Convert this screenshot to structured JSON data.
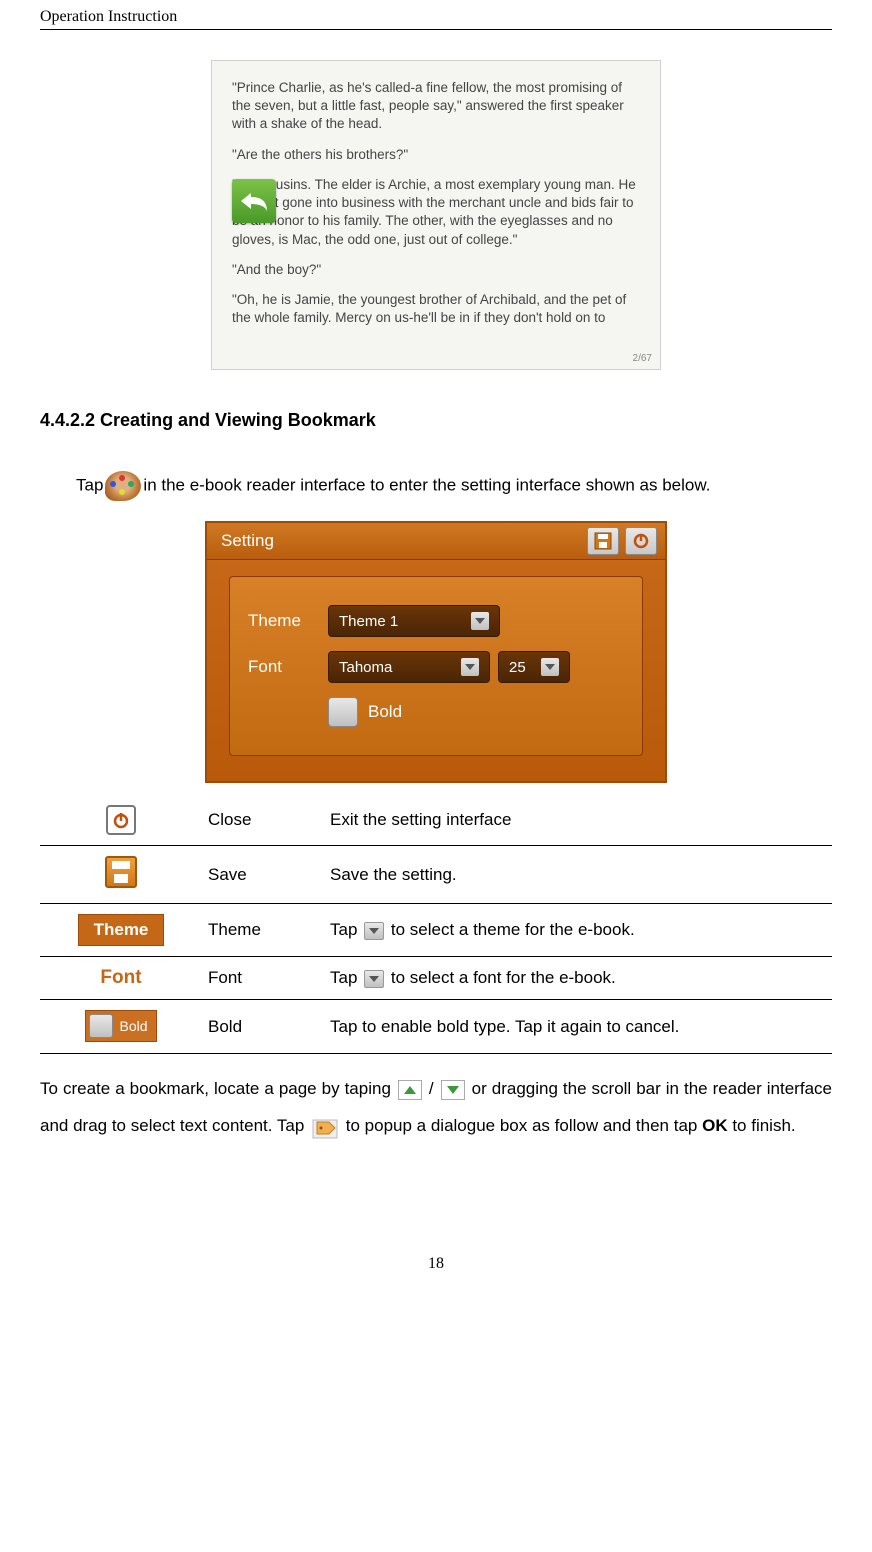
{
  "header": "Operation Instruction",
  "reader_screenshot": {
    "para1": "\"Prince Charlie, as he's called-a fine fellow, the most promising of the seven, but a little fast, people say,\" answered the first speaker with a shake of the head.",
    "para2": "\"Are the others his brothers?\"",
    "para3": "\"No, cousins. The elder is Archie, a most exemplary young man. He has just gone into business with the merchant uncle and bids fair to be an honor to his family. The other, with the eyeglasses and no gloves, is Mac, the odd one, just out of college.\"",
    "para4": "\"And the boy?\"",
    "para5": "\"Oh, he is Jamie, the youngest brother of Archibald, and the pet of the whole family. Mercy on us-he'll be in if they don't hold on to",
    "page_small": "2/67"
  },
  "section_title": "4.4.2.2 Creating and Viewing Bookmark",
  "intro_line_before": "Tap",
  "intro_line_after": "in the e-book reader interface to enter the setting interface shown as below.",
  "settings_screenshot": {
    "title": "Setting",
    "row_theme_label": "Theme",
    "row_theme_value": "Theme 1",
    "row_font_label": "Font",
    "row_font_value": "Tahoma",
    "row_font_size": "25",
    "row_bold_label": "Bold"
  },
  "table": {
    "rows": [
      {
        "label": "Close",
        "desc_before": "Exit the setting interface",
        "desc_after": "",
        "has_arrow": false
      },
      {
        "label": "Save",
        "desc_before": "Save the setting.",
        "desc_after": "",
        "has_arrow": false
      },
      {
        "label": "Theme",
        "desc_before": "Tap ",
        "desc_after": " to select a theme for the e-book.",
        "has_arrow": true
      },
      {
        "label": "Font",
        "desc_before": "Tap ",
        "desc_after": " to select a font for the e-book.",
        "has_arrow": true
      },
      {
        "label": "Bold",
        "desc_before": "Tap to enable bold type. Tap it again to cancel.",
        "desc_after": "",
        "has_arrow": false
      }
    ],
    "theme_chip_text": "Theme",
    "font_chip_text": "Font",
    "bold_chip_text": "Bold"
  },
  "footer_para": {
    "part1": "To create a bookmark, locate a page by taping  ",
    "slash": " / ",
    "part2": " or dragging the scroll bar in the reader interface and drag to select text content. Tap ",
    "part3": " to popup a dialogue box as follow and then tap ",
    "ok": "OK",
    "part4": " to finish."
  },
  "page_number": "18"
}
